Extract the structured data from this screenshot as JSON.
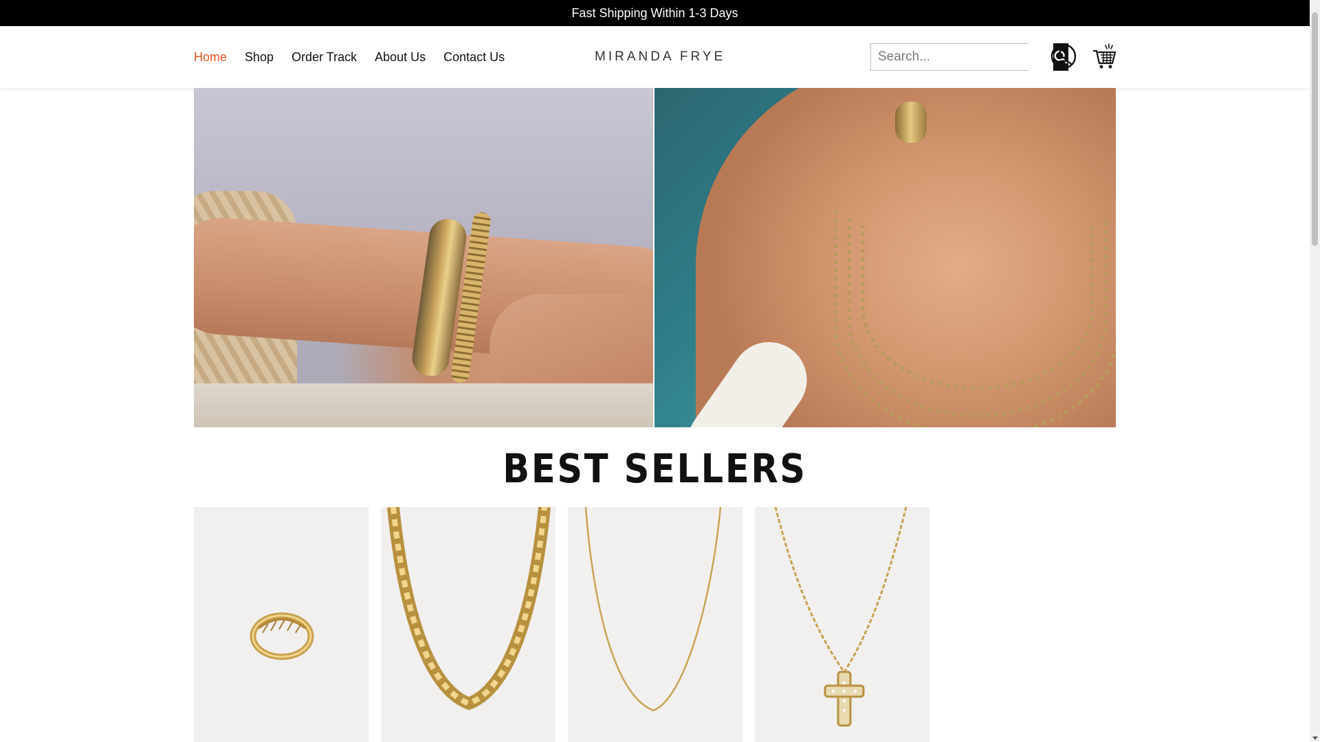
{
  "announcement": {
    "text": "Fast Shipping Within 1-3 Days"
  },
  "nav": {
    "items": [
      {
        "label": "Home",
        "active": true
      },
      {
        "label": "Shop",
        "active": false
      },
      {
        "label": "Order Track",
        "active": false
      },
      {
        "label": "About Us",
        "active": false
      },
      {
        "label": "Contact Us",
        "active": false
      }
    ],
    "active_color": "#e8501e"
  },
  "brand": {
    "logo_text": "MIRANDA FRYE"
  },
  "search": {
    "placeholder": "Search...",
    "value": "",
    "button_icon": "search-icon"
  },
  "header_icons": {
    "account": "user-account-icon",
    "cart": "shopping-cart-icon"
  },
  "hero": {
    "left_image": "model-wrist-with-gold-bracelets-and-woven-bag",
    "right_image": "model-neck-with-layered-gold-bead-necklaces"
  },
  "best_sellers": {
    "title": "BEST SELLERS",
    "products": [
      {
        "image": "gold-croissant-ring"
      },
      {
        "image": "gold-box-chain-necklace"
      },
      {
        "image": "thin-gold-chain-necklace"
      },
      {
        "image": "gold-cross-pendant-necklace"
      }
    ]
  }
}
